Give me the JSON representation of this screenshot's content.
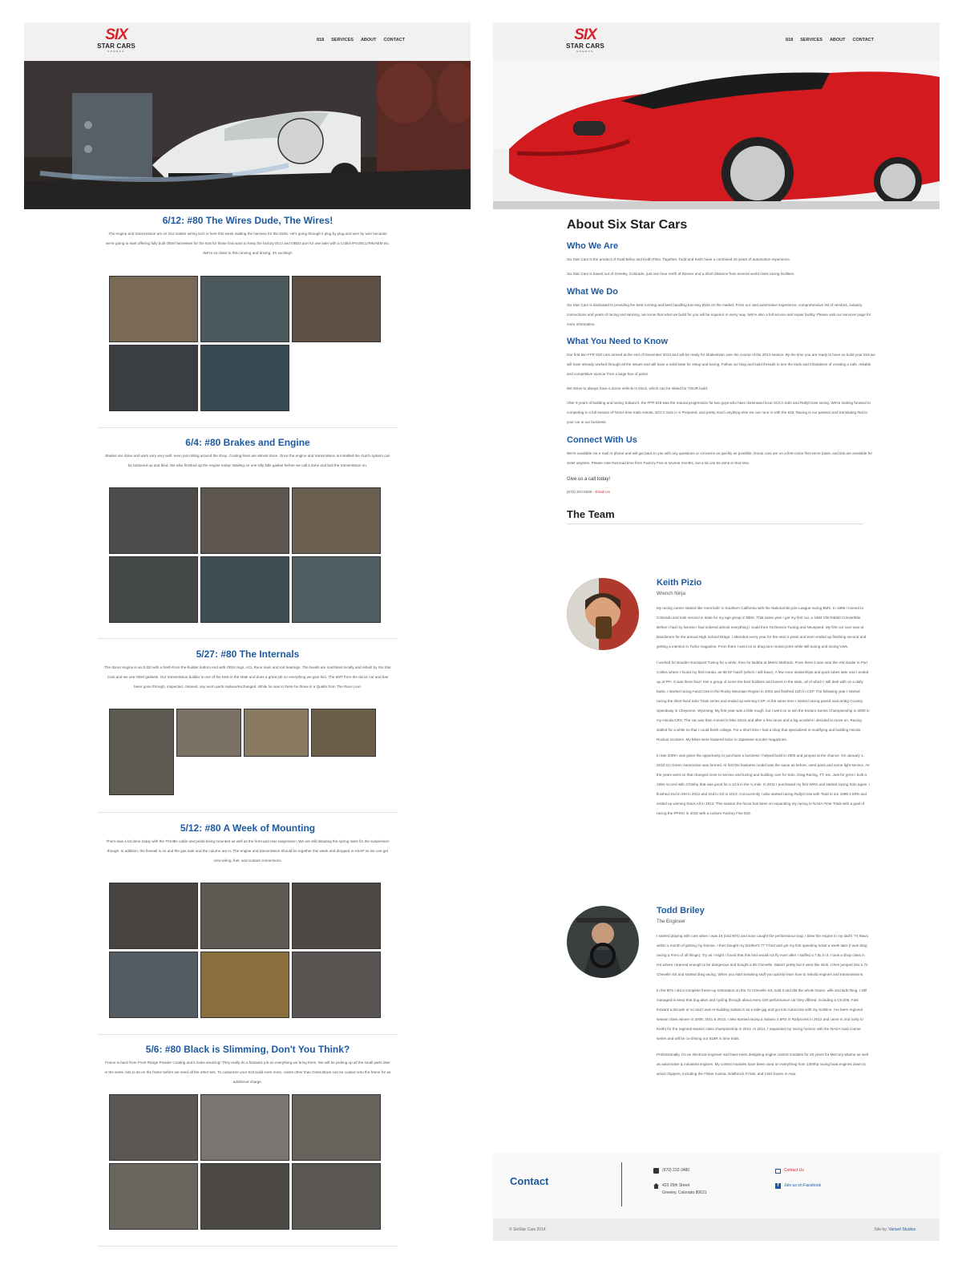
{
  "brand": {
    "mark": "SIX",
    "name": "STAR CARS",
    "sub": "SRBNCS"
  },
  "nav": [
    "818",
    "SERVICES",
    "ABOUT",
    "CONTACT"
  ],
  "posts": [
    {
      "title": "6/12: #80 The Wires Dude, The Wires!",
      "body": "The engine and transmission are in! Our master wiring tech is here this week making the harness for the 818S. He's going through it plug by plug and wire by wire because we're going to start offering fully built OEM harnesses for the 818 for those that want to keep the factory ECU and OBD2 port for use later with a Cobb/VPec/ECUTek/AEM etc. We're so close to this running and driving, it's exciting!!"
    },
    {
      "title": "6/4: #80 Brakes and Engine",
      "body": "Brakes are done and work very very well, even just rolling around the shop. Cooling lines are almost done. Once the engine and transmission is installed the clutch system can be buttoned up and bled. We also finished up the engine today! Waiting on one silly little gasket before we call it done and bolt the transmission on."
    },
    {
      "title": "5/27: #80 The Internals",
      "body": "The donor engine is an EJ20 with a fresh-from-the-builder bottom end with OEM rings, ACL Race main and rod bearings. The heads are machined locally and rebuilt by Six Star Cars and we use OEM gaskets. Our transmission builder is one of the best in the state and does a great job on everything we give him. The 5MT from the donor car and has been gone through, inspected, cleaned, any worn parts replace/exchanged. While he was in there he threw in a Quaife from The Race Line."
    },
    {
      "title": "5/12: #80 A Week of Mounting",
      "body": "There was a lot done today with the Throttle cable and pedal being mounted as well as the front and rear suspension. We are still debating the spring rates for the suspension though. In addition, the firewall is on and the gas tank and the column are in. The engine and transmission should be together this week and dropped in ASAP so we can get onto wiring, fuel, and coolant connections."
    },
    {
      "title": "5/6: #80 Black is Slimming, Don't You Think?",
      "body": "Frame is back from Front Range Powder Coating and it looks amazing! They really do a fantastic job on everything we bring them. We will be picking up all the small parts later in the week, lots to do on the frame before we need all the other bits. To customize your 818 build even more, colors other than Gloss Black can be coated onto the frame for an additional charge."
    }
  ],
  "about": {
    "title": "About Six Star Cars",
    "who_h": "Who We Are",
    "who_p1": "Six Star Cars is the product of Todd Briley and Keith Pizio. Together, Todd and Keith have a combined 43 years of automotive experience.",
    "who_p2": "Six Star Cars is based out of Greeley, Colorado, just one hour north of Denver and a short distance from several world class racing facilities.",
    "what_h": "What We Do",
    "what_p": "Six Star Cars is dedicated to providing the best running and best handling turn-key 818s on the market. From our vast automotive experience, comprehensive list of vendors, industry connections and years of racing and winning, we know that what we build for you will be superior in every way. We're also a full service and repair facility. Please visit our services page for more information.",
    "need_h": "What You Need to Know",
    "need_p1": "Our first two FFR 818 cars arrived at the end of November 2013 and will be ready for shakedown over the course of the 2014 season. By the time you are ready to have us build your 818 we will have already worked through all the issues and will have a solid base for setup and tuning. Follow our blog and build threads to see the trials and tribulations of creating a safe, reliable, and competitive racecar from a large box of parts!",
    "need_p2": "We strive to always have a donor vehicle in stock, which can be slated for YOUR build.",
    "need_p3": "After 9 years of building and racing Subaru's, the FFR 818 was the natural progression for two guys who have dominated local SCCA Solo and RallyCross racing. We're looking forward to competing in a full season of NASA time trials events, SCCA Solo in X Prepared, and pretty much anything else we can race in with the 818. Racing is our passion and translating that to your car is our business.",
    "conn_h": "Connect With Us",
    "conn_p": "We're available via e-mail or phone and will get back to you with any questions or concerns as quickly as possible. Donor cars are on a first-come first-serve basis, and kits are available for order anytime. Please note that lead time from Factory Five is several months, but a lot can be done in that time.",
    "call": "Give us a call today!",
    "phone": "(970) 310-5346",
    "email": "Email Us",
    "team_h": "The Team"
  },
  "team": [
    {
      "name": "Keith Pizio",
      "role": "Wrench Ninja",
      "p1": "My racing career started like most kids' in Southern California with the National Bicycle League racing BMX. In 1995 I moved to Colorado and took second in state for my age group in BMX. That same year I got my first car, a 1984 VW Rabbit Convertible. Before I had my license I had ordered almost everything I could from Techtonics Tuning and Neuspeed. My first car race was at Bandimere for the annual High School Drags. I attended every year for the next 3 years and even ended up finishing second and getting a mention in Turbo magazine. From there I went on to drag race motorcycles while still tuning and racing VWs.",
      "p2": "I worked for Boulder Eurosport Tuning for a while, then for Bubba at Metric Methodz. From there it was onto the VW dealer in Fort Collins where I found my first Honda, an 88 EF hatch (which I still have). A few more dealerships and quick lubes later and I ended up at PFI. It was there that I met a group of some the best builders and tuners in the state, all of which I still deal with on a daily basis. I started racing AutoCross in the Rocky Mountain Region in 2003 and finished 11th in CSP. The following year I started racing the short lived Solo Trials series and ended up winning CSP. At the same time I started racing paved oval at Big Country Speedway in Cheyenne, Wyoming. My first year was a little rough, but I went on to win the Enduro Series Championship in 2005 in my Honda CRX. The car was then moved to Mini Stock and after a few races and a big accident I decided to move on. Racing stalled for a while so that I could finish college. For a short time I had a shop that specialized in modifying and building Honda Ruckus scooters. My bikes were featured twice in Japanese scooter magazines.",
      "p3": "In late 2009 I was given the opportunity to purchase a business I helped build in 2005 and jumped at the chance. On January 1, 2010 Go Green Automotive was formed. At first the business model was the same as before, used parts and some light service. As the years went on that changed more to service and tuning and building cars for Solo, Drag Racing, TT, etc. Just for grins I built a 1994 Accord with 470whp that was good for a 12.6 in the ¼ mile. In 2011 I purchased my first WRX and started racing Solo again. I finished 2nd in SM in 2012 and 2nd in SS in 2013. Concurrently I also started racing RallyCross with Todd in our 1999 2.5RS and ended up winning Stock All in 2013. This season the focus has been on expanding my racing to NASA Time Trials with a goal of racing the PPIHC in 2015 with a custom Factory Five 818."
    },
    {
      "name": "Todd Briley",
      "role": "The Engineer",
      "p1": "I started playing with cars when I was 15 (mid 80's) and soon caught the performance bug. I blew the engine in my dad's '74 Mavo within a month of getting my license. I then bought my brother's 77 T-bird and got my first speeding ticket a week later (I was drag racing a Fiero of all things). Try as I might I found that this bird would not fly even after I stuffed a 7.5L in it. I took a shop class in HS where I learned enough to be dangerous and bought a 65 Chevelle. Wasn't pretty but it went like stink. I then jumped into a 72 Chevelle SS and started drag racing. When you start breaking stuff you quickly learn how to rebuild engines and transmissions.",
      "p2": "In the 90's I did a complete frame-up restoration on the 72 Chevelle SS, sold it and did the whole house, wife and kids thing. I still managed to keep that bug alive and cycling through about every GM performance car they offered, including a C5 Z06. Fast forward a decade or so and I was re-building Subaru's as a side-gig and got into Autocross with my Solstice. I've been regional season class winner in 2008, 2011 & 2013. I also started racing a Subaru 2.5RS in Rallycross in 2012 and came in 2nd (only to Keith) for the regional season class championship in 2013. In 2014, I expanded my racing horizon with the NASA road course series and will be co-driving our 818R in time trials.",
      "p3": "Professionally, I'm an electrical engineer and have been designing engine control modules for 20 years for Mercury Marine as well as automotive & industrial engines. My control modules have been used on everything from 1300hp racing boat engines down to wood chippers, including the Fisker Karma, Edelbrock FI kits, and CNG buses in Asia."
    }
  ],
  "contact": {
    "heading": "Contact",
    "phone": "(970) 232-3480",
    "addr1": "423 25th Street",
    "addr2": "Greeley, Colorado 80631",
    "email": "Contact Us",
    "facebook": "Join us on Facebook"
  },
  "footer": {
    "copy": "© SixStar Cars 2014",
    "site_by": "Site by:",
    "studio": "Variant Studios"
  },
  "colors": {
    "accent": "#1e5aa0",
    "brand_red": "#d8232a",
    "link_red": "#d8232a"
  }
}
